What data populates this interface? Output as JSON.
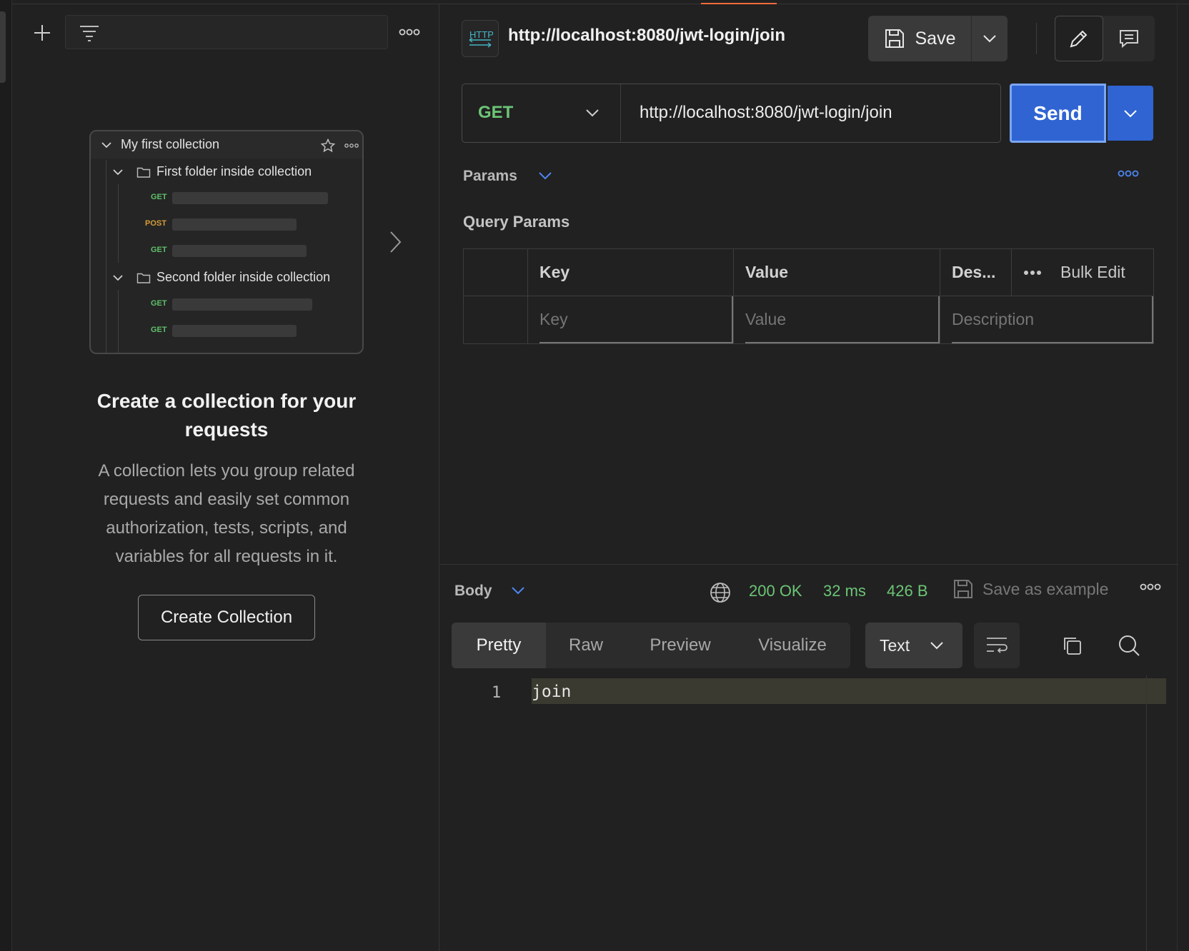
{
  "app": {
    "accent_color": "#2f64d2",
    "method_color": "#6cc576",
    "tab_indicator_color": "#f26b3a"
  },
  "sidebar": {
    "add_icon": "plus-icon",
    "filter_icon": "filter-icon",
    "more_icon": "more-horizontal-icon",
    "illustration": {
      "collection_name": "My first collection",
      "folders": [
        {
          "name": "First folder inside collection",
          "requests": [
            "GET",
            "POST",
            "GET"
          ]
        },
        {
          "name": "Second folder inside collection",
          "requests": [
            "GET",
            "GET"
          ]
        }
      ]
    },
    "empty_state": {
      "title": "Create a collection for your requests",
      "description": "A collection lets you group related requests and easily set common authorization, tests, scripts, and variables for all requests in it.",
      "button_label": "Create Collection"
    }
  },
  "request": {
    "title": "http://localhost:8080/jwt-login/join",
    "save_label": "Save",
    "method": "GET",
    "url": "http://localhost:8080/jwt-login/join",
    "send_label": "Send",
    "params_label": "Params",
    "query_params_label": "Query Params",
    "table": {
      "headers": {
        "key": "Key",
        "value": "Value",
        "description": "Des...",
        "bulk_edit": "Bulk Edit"
      },
      "placeholders": {
        "key": "Key",
        "value": "Value",
        "description": "Description"
      }
    }
  },
  "response": {
    "body_label": "Body",
    "status": "200 OK",
    "time": "32 ms",
    "size": "426 B",
    "save_example_label": "Save as example",
    "tabs": [
      "Pretty",
      "Raw",
      "Preview",
      "Visualize"
    ],
    "active_tab": "Pretty",
    "format": "Text",
    "lines": [
      {
        "number": "1",
        "text": "join"
      }
    ]
  }
}
